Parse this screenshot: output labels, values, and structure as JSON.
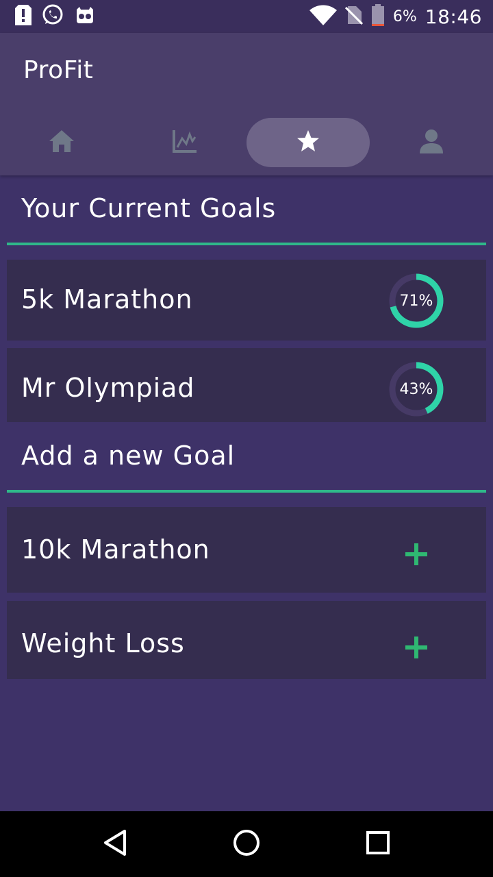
{
  "status_bar": {
    "battery_percent": "6%",
    "time": "18:46",
    "icons": [
      "alert-icon",
      "whatsapp-icon",
      "cyanogen-icon",
      "wifi-icon",
      "no-sim-icon",
      "battery-icon"
    ]
  },
  "app": {
    "title": "ProFit"
  },
  "tabs": [
    {
      "icon": "home-icon",
      "active": false
    },
    {
      "icon": "chart-icon",
      "active": false
    },
    {
      "icon": "star-icon",
      "active": true
    },
    {
      "icon": "person-icon",
      "active": false
    }
  ],
  "current_goals": {
    "title": "Your Current Goals",
    "items": [
      {
        "label": "5k Marathon",
        "progress_text": "71%",
        "progress": 0.71
      },
      {
        "label": "Mr Olympiad",
        "progress_text": "43%",
        "progress": 0.43
      }
    ]
  },
  "new_goal": {
    "title": "Add a new Goal",
    "items": [
      {
        "label": "10k Marathon",
        "action_icon": "plus-icon"
      },
      {
        "label": "Weight Loss",
        "action_icon": "plus-icon"
      }
    ]
  },
  "colors": {
    "background": "#3e3268",
    "app_bar": "#4a3e6a",
    "card": "#352d4f",
    "accent": "#2fd3a8",
    "divider": "#2fb88a",
    "plus": "#2fb872"
  },
  "nav": {
    "icons": [
      "back-icon",
      "home-circle-icon",
      "recents-icon"
    ]
  }
}
